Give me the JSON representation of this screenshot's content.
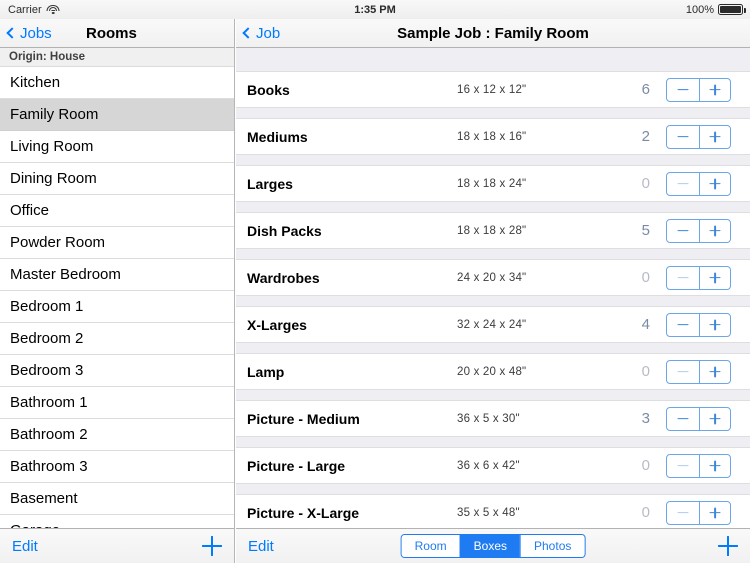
{
  "status_bar": {
    "carrier": "Carrier",
    "wifi_icon": "wifi-icon",
    "time": "1:35 PM",
    "battery_percent": "100%",
    "battery_icon": "battery-full-icon"
  },
  "sidebar": {
    "nav": {
      "back_label": "Jobs",
      "back_icon": "chevron-left-icon",
      "title": "Rooms"
    },
    "section_header": "Origin: House",
    "selected_room": "Family Room",
    "rooms": [
      {
        "label": "Kitchen"
      },
      {
        "label": "Family Room"
      },
      {
        "label": "Living Room"
      },
      {
        "label": "Dining Room"
      },
      {
        "label": "Office"
      },
      {
        "label": "Powder Room"
      },
      {
        "label": "Master Bedroom"
      },
      {
        "label": "Bedroom 1"
      },
      {
        "label": "Bedroom 2"
      },
      {
        "label": "Bedroom 3"
      },
      {
        "label": "Bathroom 1"
      },
      {
        "label": "Bathroom 2"
      },
      {
        "label": "Bathroom 3"
      },
      {
        "label": "Basement"
      },
      {
        "label": "Garage"
      }
    ],
    "toolbar": {
      "edit_label": "Edit",
      "add_icon": "plus-icon"
    }
  },
  "detail": {
    "nav": {
      "back_label": "Job",
      "back_icon": "chevron-left-icon",
      "title": "Sample Job : Family Room"
    },
    "stepper": {
      "decrement_icon": "minus-icon",
      "increment_icon": "plus-icon"
    },
    "boxes": [
      {
        "name": "Books",
        "dims": "16 x 12 x 12\"",
        "count": "6"
      },
      {
        "name": "Mediums",
        "dims": "18 x 18 x 16\"",
        "count": "2"
      },
      {
        "name": "Larges",
        "dims": "18 x 18 x 24\"",
        "count": "0"
      },
      {
        "name": "Dish Packs",
        "dims": "18 x 18 x 28\"",
        "count": "5"
      },
      {
        "name": "Wardrobes",
        "dims": "24 x 20 x 34\"",
        "count": "0"
      },
      {
        "name": "X-Larges",
        "dims": "32 x 24 x 24\"",
        "count": "4"
      },
      {
        "name": "Lamp",
        "dims": "20 x 20 x 48\"",
        "count": "0"
      },
      {
        "name": "Picture - Medium",
        "dims": "36 x 5 x 30\"",
        "count": "3"
      },
      {
        "name": "Picture - Large",
        "dims": "36 x 6 x 42\"",
        "count": "0"
      },
      {
        "name": "Picture - X-Large",
        "dims": "35 x 5 x 48\"",
        "count": "0"
      }
    ],
    "toolbar": {
      "edit_label": "Edit",
      "add_icon": "plus-icon",
      "segments": [
        {
          "label": "Room",
          "active": false
        },
        {
          "label": "Boxes",
          "active": true
        },
        {
          "label": "Photos",
          "active": false
        }
      ]
    }
  },
  "colors": {
    "tint": "#007aff",
    "segment_blue": "#1f7bf2",
    "stepper_border": "#6ba6e8",
    "selected_row": "#d6d6d6",
    "list_background": "#eeeef3"
  }
}
